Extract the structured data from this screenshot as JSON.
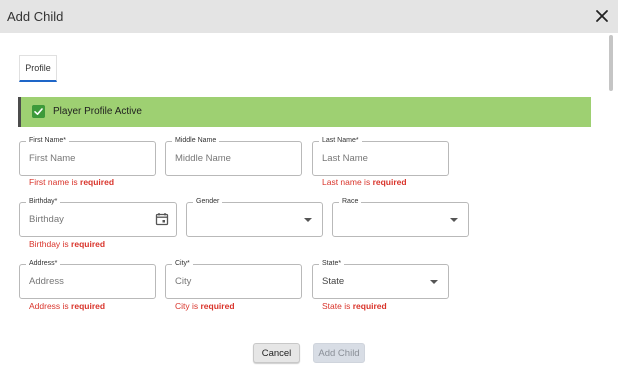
{
  "dialog": {
    "title": "Add Child"
  },
  "tabs": [
    {
      "label": "Profile"
    }
  ],
  "banner": {
    "label": "Player Profile Active"
  },
  "fields": {
    "first_name": {
      "label": "First Name*",
      "placeholder": "First Name",
      "error_prefix": "First name is ",
      "error_strong": "required"
    },
    "middle_name": {
      "label": "Middle Name",
      "placeholder": "Middle Name"
    },
    "last_name": {
      "label": "Last Name*",
      "placeholder": "Last Name",
      "error_prefix": "Last name is ",
      "error_strong": "required"
    },
    "birthday": {
      "label": "Birthday*",
      "placeholder": "Birthday",
      "error_prefix": "Birthday is ",
      "error_strong": "required"
    },
    "gender": {
      "label": "Gender",
      "value": ""
    },
    "race": {
      "label": "Race",
      "value": ""
    },
    "address": {
      "label": "Address*",
      "placeholder": "Address",
      "error_prefix": "Address is ",
      "error_strong": "required"
    },
    "city": {
      "label": "City*",
      "placeholder": "City",
      "error_prefix": "City is ",
      "error_strong": "required"
    },
    "state": {
      "label": "State*",
      "value": "State",
      "error_prefix": "State is ",
      "error_strong": "required"
    }
  },
  "buttons": {
    "cancel": "Cancel",
    "add_child": "Add Child"
  },
  "colors": {
    "banner": "#9ed072",
    "error": "#d9342b",
    "tab_underline": "#1e66c8",
    "checkbox": "#3d9a3a"
  }
}
